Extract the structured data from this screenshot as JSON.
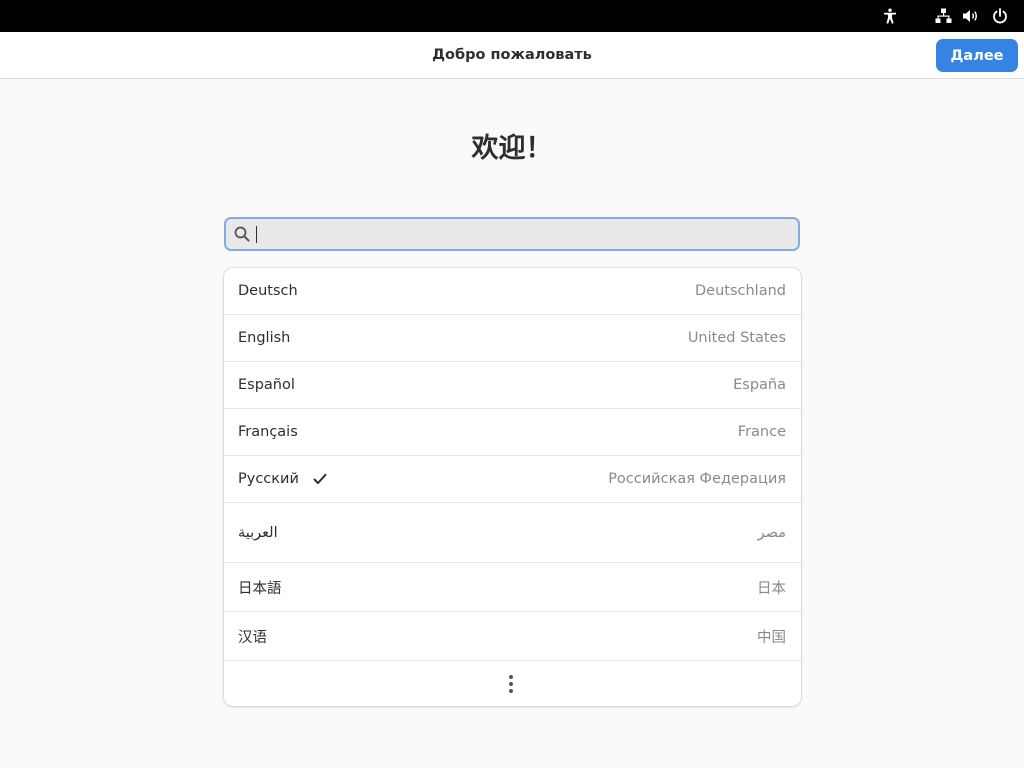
{
  "header": {
    "title": "Добро пожаловать",
    "next_label": "Далее"
  },
  "welcome": "欢迎！",
  "search": {
    "value": "",
    "placeholder": ""
  },
  "languages": [
    {
      "name": "Deutsch",
      "region": "Deutschland",
      "selected": false
    },
    {
      "name": "English",
      "region": "United States",
      "selected": false
    },
    {
      "name": "Español",
      "region": "España",
      "selected": false
    },
    {
      "name": "Français",
      "region": "France",
      "selected": false
    },
    {
      "name": "Русский",
      "region": "Российская Федерация",
      "selected": true
    },
    {
      "name": "العربية",
      "region": "مصر",
      "selected": false
    },
    {
      "name": "日本語",
      "region": "日本",
      "selected": false
    },
    {
      "name": "汉语",
      "region": "中国",
      "selected": false
    }
  ],
  "icons": {
    "topbar": [
      "accessibility-icon",
      "network-icon",
      "volume-icon",
      "power-icon"
    ],
    "search": "search-icon",
    "selected": "check-icon",
    "more": "more-vertical-icon"
  },
  "colors": {
    "accent": "#3584e4",
    "topbar": "#000000",
    "background": "#fafafa"
  }
}
